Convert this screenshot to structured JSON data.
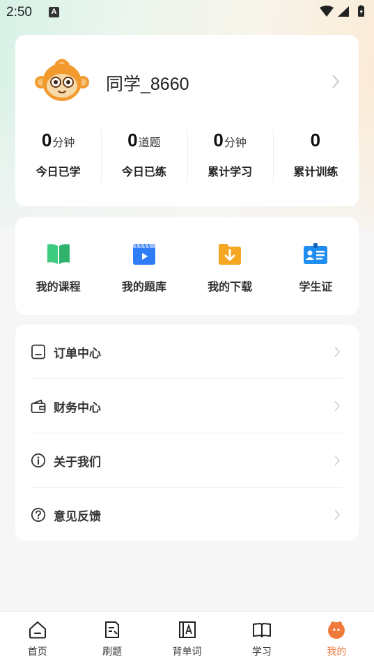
{
  "status_bar": {
    "time": "2:50",
    "notification_badge": "A"
  },
  "profile": {
    "username": "同学_8660",
    "stats": [
      {
        "value": "0",
        "unit": "分钟",
        "label": "今日已学"
      },
      {
        "value": "0",
        "unit": "道题",
        "label": "今日已练"
      },
      {
        "value": "0",
        "unit": "分钟",
        "label": "累计学习"
      },
      {
        "value": "0",
        "unit": "",
        "label": "累计训练"
      }
    ]
  },
  "quick_menu": [
    {
      "label": "我的课程",
      "icon": "book-icon"
    },
    {
      "label": "我的题库",
      "icon": "video-icon"
    },
    {
      "label": "我的下载",
      "icon": "download-folder-icon"
    },
    {
      "label": "学生证",
      "icon": "id-card-icon"
    }
  ],
  "menu_list": [
    {
      "label": "订单中心",
      "icon": "order-icon"
    },
    {
      "label": "财务中心",
      "icon": "wallet-icon"
    },
    {
      "label": "关于我们",
      "icon": "info-icon"
    },
    {
      "label": "意见反馈",
      "icon": "help-icon"
    }
  ],
  "bottom_nav": [
    {
      "label": "首页",
      "icon": "home-icon",
      "active": false
    },
    {
      "label": "刷题",
      "icon": "practice-icon",
      "active": false
    },
    {
      "label": "背单词",
      "icon": "vocabulary-icon",
      "active": false
    },
    {
      "label": "学习",
      "icon": "study-book-icon",
      "active": false
    },
    {
      "label": "我的",
      "icon": "profile-icon",
      "active": true
    }
  ],
  "colors": {
    "accent": "#f07a3c",
    "book_green": "#3ccb7f",
    "video_blue": "#2f7df6",
    "download_orange": "#f5a623",
    "id_blue": "#1f8ef1"
  }
}
